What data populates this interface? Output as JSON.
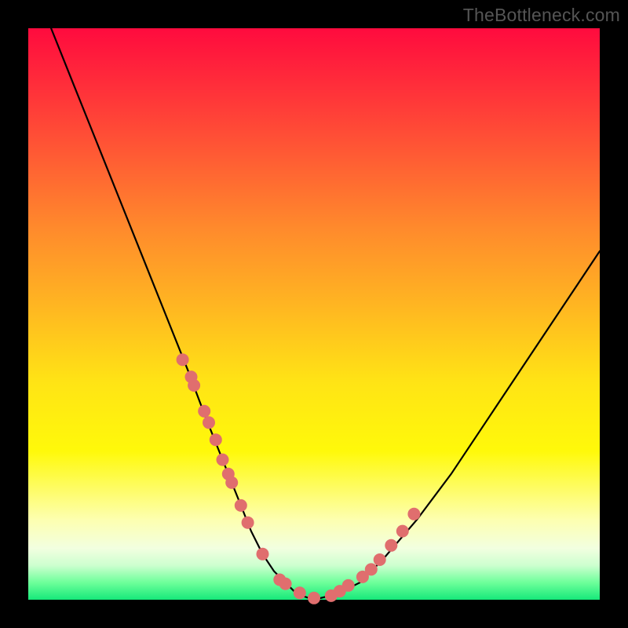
{
  "watermark": "TheBottleneck.com",
  "colors": {
    "dot": "#e06e6e",
    "line": "#000000",
    "frame": "#000000"
  },
  "chart_data": {
    "type": "line",
    "title": "",
    "xlabel": "",
    "ylabel": "",
    "xlim": [
      0,
      100
    ],
    "ylim": [
      0,
      100
    ],
    "grid": false,
    "series": [
      {
        "name": "bottleneck-curve",
        "x": [
          0,
          4,
          8,
          12,
          16,
          20,
          24,
          28,
          31,
          33,
          35,
          37,
          39,
          41,
          43,
          45,
          47,
          50,
          54,
          58,
          62,
          68,
          74,
          80,
          88,
          96,
          100
        ],
        "values": [
          110,
          100,
          90,
          80,
          70,
          60,
          50,
          40,
          32,
          27,
          22,
          17,
          12,
          8,
          5,
          3,
          1,
          0,
          1,
          3,
          7,
          14,
          22,
          31,
          43,
          55,
          61
        ]
      }
    ],
    "dots": {
      "name": "highlight-points",
      "x": [
        27.0,
        28.5,
        29.0,
        30.8,
        31.6,
        32.8,
        34.0,
        35.0,
        35.6,
        37.2,
        38.4,
        41.0,
        44.0,
        45.0,
        47.5,
        50.0,
        53.0,
        54.5,
        56.0,
        58.5,
        60.0,
        61.5,
        63.5,
        65.5,
        67.5
      ],
      "values": [
        42.0,
        39.0,
        37.5,
        33.0,
        31.0,
        28.0,
        24.5,
        22.0,
        20.5,
        16.5,
        13.5,
        8.0,
        3.5,
        2.8,
        1.2,
        0.3,
        0.7,
        1.5,
        2.5,
        4.0,
        5.3,
        7.0,
        9.5,
        12.0,
        15.0
      ]
    }
  }
}
